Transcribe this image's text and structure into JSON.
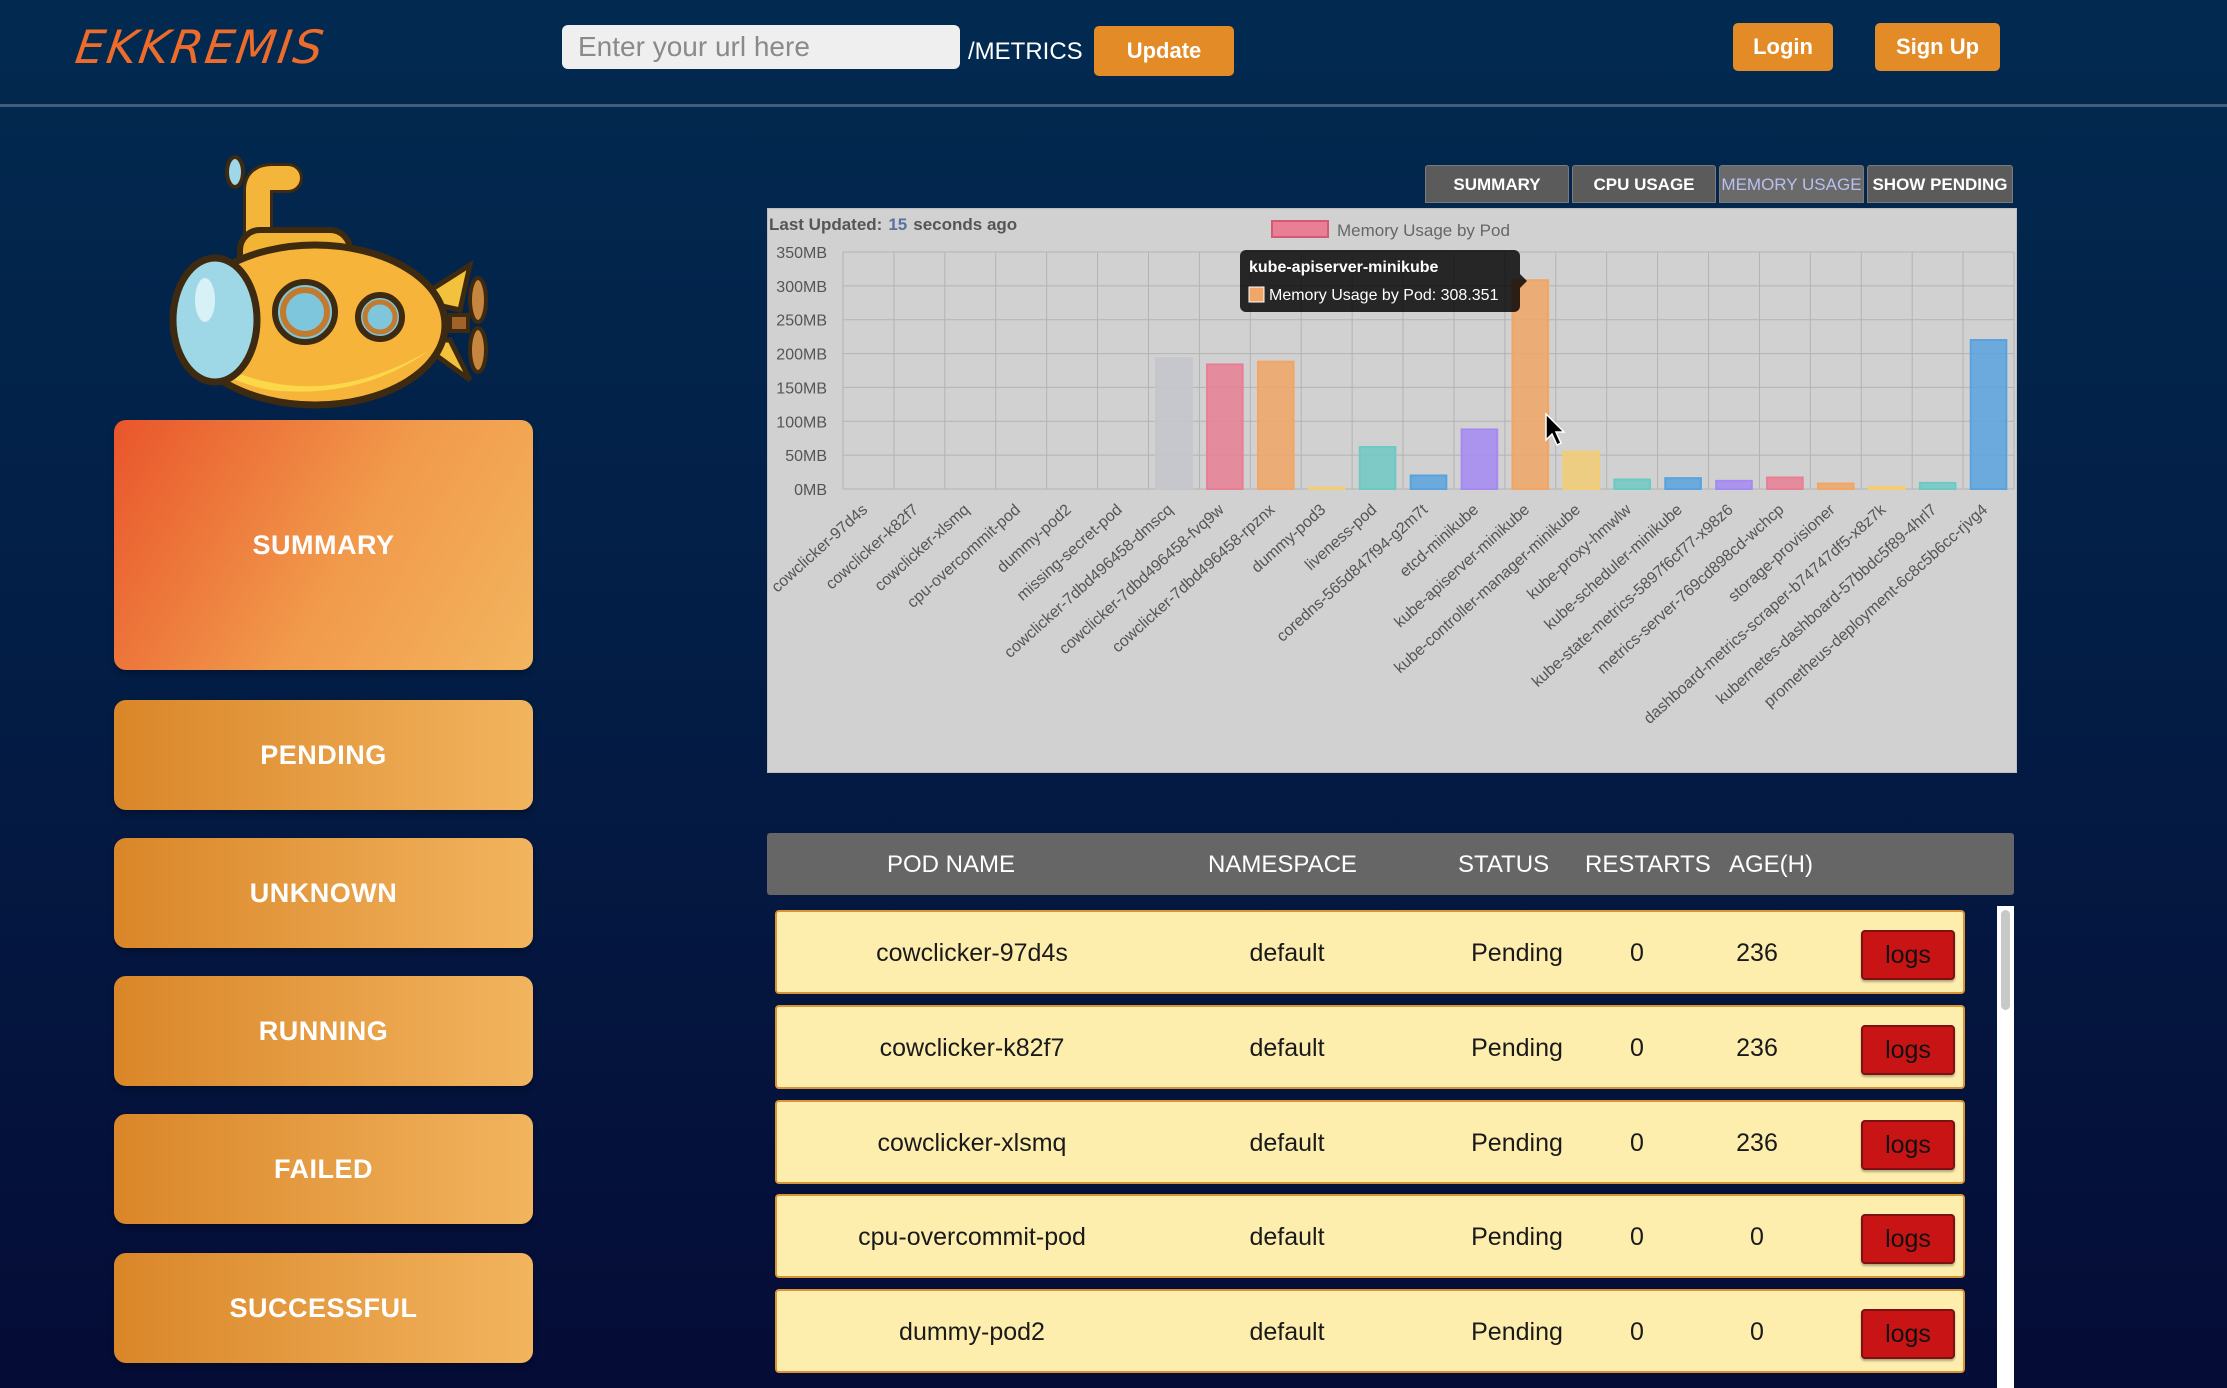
{
  "header": {
    "logo": "EKKREMIS",
    "url_placeholder": "Enter your url here",
    "metrics_label": "/METRICS",
    "update_label": "Update",
    "login_label": "Login",
    "signup_label": "Sign Up"
  },
  "sidebar": {
    "mascot_icon": "submarine-icon",
    "items": [
      {
        "label": "SUMMARY",
        "active": true
      },
      {
        "label": "PENDING"
      },
      {
        "label": "UNKNOWN"
      },
      {
        "label": "RUNNING"
      },
      {
        "label": "FAILED"
      },
      {
        "label": "SUCCESSFUL"
      }
    ]
  },
  "tabs": [
    "SUMMARY",
    "CPU USAGE",
    "MEMORY USAGE",
    "SHOW PENDING"
  ],
  "active_tab": "MEMORY USAGE",
  "chart": {
    "last_updated_label": "Last Updated:",
    "last_updated_value": "15",
    "last_updated_suffix": "seconds ago",
    "tooltip_title": "kube-apiserver-minikube",
    "tooltip_body": "Memory Usage by Pod: 308.351"
  },
  "chart_data": {
    "type": "bar",
    "legend": "Memory Usage by Pod",
    "legend_position": "top",
    "grid": true,
    "ylim": [
      0,
      350
    ],
    "yticks": [
      "0MB",
      "50MB",
      "100MB",
      "150MB",
      "200MB",
      "250MB",
      "300MB",
      "350MB"
    ],
    "categories": [
      "cowclicker-97d4s",
      "cowclicker-k82f7",
      "cowclicker-xlsmq",
      "cpu-overcommit-pod",
      "dummy-pod2",
      "missing-secret-pod",
      "cowclicker-7dbd496458-dmscq",
      "cowclicker-7dbd496458-fvq9w",
      "cowclicker-7dbd496458-rpznx",
      "dummy-pod3",
      "liveness-pod",
      "coredns-565d847f94-g2m7t",
      "etcd-minikube",
      "kube-apiserver-minikube",
      "kube-controller-manager-minikube",
      "kube-proxy-hmwlw",
      "kube-scheduler-minikube",
      "kube-state-metrics-5897f6cf77-x98z6",
      "metrics-server-769cd898cd-wchcp",
      "storage-provisioner",
      "dashboard-metrics-scraper-b74747df5-x8z7k",
      "kubernetes-dashboard-57bbdc5f89-4hrl7",
      "prometheus-deployment-6c8c5b6cc-rjvg4"
    ],
    "values": [
      0,
      0,
      0,
      0,
      0,
      0,
      193,
      184,
      188,
      2,
      62,
      20,
      88,
      308.351,
      55,
      14,
      16,
      12,
      17,
      8,
      3,
      9,
      220
    ],
    "colors": [
      "#e87f94",
      "#f0a666",
      "#f2cd73",
      "#6ec9c4",
      "#5aa2de",
      "#a58af2",
      "#c4c6cb",
      "#e87f94",
      "#f0a666",
      "#f2cd73",
      "#6ec9c4",
      "#5aa2de",
      "#a58af2",
      "#f0a666",
      "#f2cd73",
      "#6ec9c4",
      "#5aa2de",
      "#a58af2",
      "#e87f94",
      "#f0a666",
      "#f2cd73",
      "#6ec9c4",
      "#5aa2de"
    ]
  },
  "table": {
    "headers": [
      "POD NAME",
      "NAMESPACE",
      "STATUS",
      "RESTARTS",
      "AGE(H)"
    ],
    "rows": [
      {
        "name": "cowclicker-97d4s",
        "namespace": "default",
        "status": "Pending",
        "restarts": "0",
        "age": "236",
        "action": "logs"
      },
      {
        "name": "cowclicker-k82f7",
        "namespace": "default",
        "status": "Pending",
        "restarts": "0",
        "age": "236",
        "action": "logs"
      },
      {
        "name": "cowclicker-xlsmq",
        "namespace": "default",
        "status": "Pending",
        "restarts": "0",
        "age": "236",
        "action": "logs"
      },
      {
        "name": "cpu-overcommit-pod",
        "namespace": "default",
        "status": "Pending",
        "restarts": "0",
        "age": "0",
        "action": "logs"
      },
      {
        "name": "dummy-pod2",
        "namespace": "default",
        "status": "Pending",
        "restarts": "0",
        "age": "0",
        "action": "logs"
      }
    ]
  }
}
